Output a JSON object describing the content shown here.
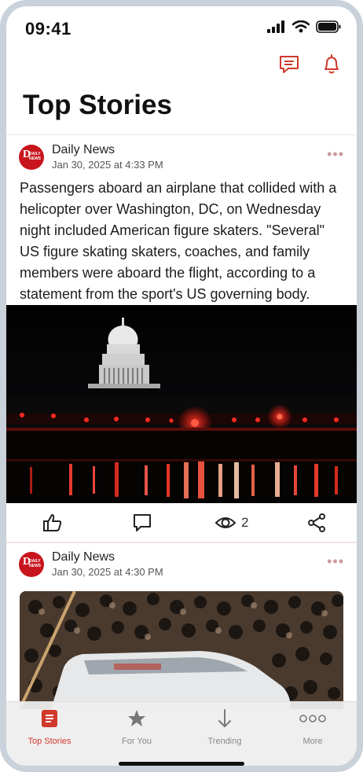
{
  "status": {
    "time": "09:41"
  },
  "header": {
    "title": "Top Stories",
    "icons": [
      "chat-icon",
      "bell-icon"
    ]
  },
  "colors": {
    "accent": "#d0392b",
    "brand_red": "#c8141c",
    "tab_inactive": "#888888"
  },
  "posts": [
    {
      "source": "Daily News",
      "logo_text": "D",
      "logo_small": "DAILY NEWS",
      "date": "Jan 30, 2025 at 4:33 PM",
      "more": "•••",
      "text": "Passengers aboard an airplane that collided with a helicopter over Washington, DC, on Wednesday night included American figure skaters.  \"Several\" US figure skating skaters, coaches, and family members were aboard the flight, according to a statement from the sport's US governing body.",
      "views": "2"
    },
    {
      "source": "Daily News",
      "logo_text": "D",
      "logo_small": "DAILY NEWS",
      "date": "Jan 30, 2025 at 4:30 PM",
      "more": "•••"
    }
  ],
  "tabs": [
    {
      "label": "Top Stories",
      "icon": "news-icon",
      "active": true
    },
    {
      "label": "For You",
      "icon": "star-icon",
      "active": false
    },
    {
      "label": "Trending",
      "icon": "arrow-down-icon",
      "active": false
    },
    {
      "label": "More",
      "icon": "more-icon",
      "active": false
    }
  ]
}
